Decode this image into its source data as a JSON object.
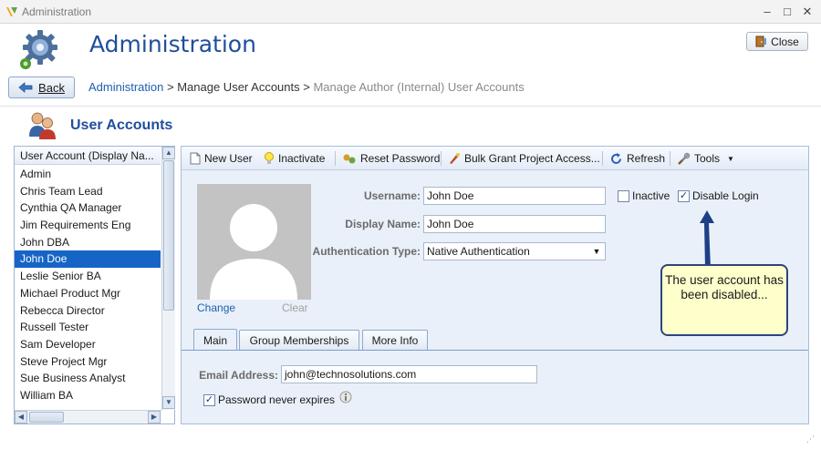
{
  "window": {
    "title": "Administration",
    "minimize_glyph": "–",
    "maximize_glyph": "□",
    "close_glyph": "✕"
  },
  "header": {
    "title": "Administration",
    "close_label": "Close",
    "back_label": "Back"
  },
  "breadcrumb": {
    "root": "Administration",
    "sep": ">",
    "current": "Manage User Accounts",
    "next": "Manage Author (Internal) User Accounts"
  },
  "section": {
    "title": "User Accounts"
  },
  "user_list": {
    "header": "User Account (Display Na...",
    "items": [
      "Admin",
      "Chris Team Lead",
      "Cynthia QA Manager",
      "Jim Requirements Eng",
      "John DBA",
      "John Doe",
      "Leslie Senior BA",
      "Michael Product Mgr",
      "Rebecca Director",
      "Russell Tester",
      "Sam Developer",
      "Steve Project Mgr",
      "Sue Business Analyst",
      "William BA"
    ],
    "selected": "John Doe"
  },
  "toolbar": {
    "new_user": "New User",
    "inactivate": "Inactivate",
    "reset_password": "Reset Password",
    "bulk_grant": "Bulk Grant Project Access...",
    "refresh": "Refresh",
    "tools": "Tools"
  },
  "avatar": {
    "change": "Change",
    "clear": "Clear"
  },
  "form": {
    "username_label": "Username:",
    "username_value": "John Doe",
    "display_name_label": "Display Name:",
    "display_name_value": "John Doe",
    "auth_type_label": "Authentication Type:",
    "auth_type_value": "Native Authentication",
    "inactive_label": "Inactive",
    "inactive_checked": false,
    "disable_login_label": "Disable Login",
    "disable_login_checked": true
  },
  "tabs": [
    "Main",
    "Group Memberships",
    "More Info"
  ],
  "main_tab": {
    "email_label": "Email Address:",
    "email_value": "john@technosolutions.com",
    "password_never_expires_label": "Password never expires",
    "password_never_expires_checked": true
  },
  "callout": {
    "text": "The user account has been disabled..."
  },
  "colors": {
    "accent": "#1f4e9c",
    "selection": "#1665c6",
    "callout_bg": "#ffffcc"
  }
}
